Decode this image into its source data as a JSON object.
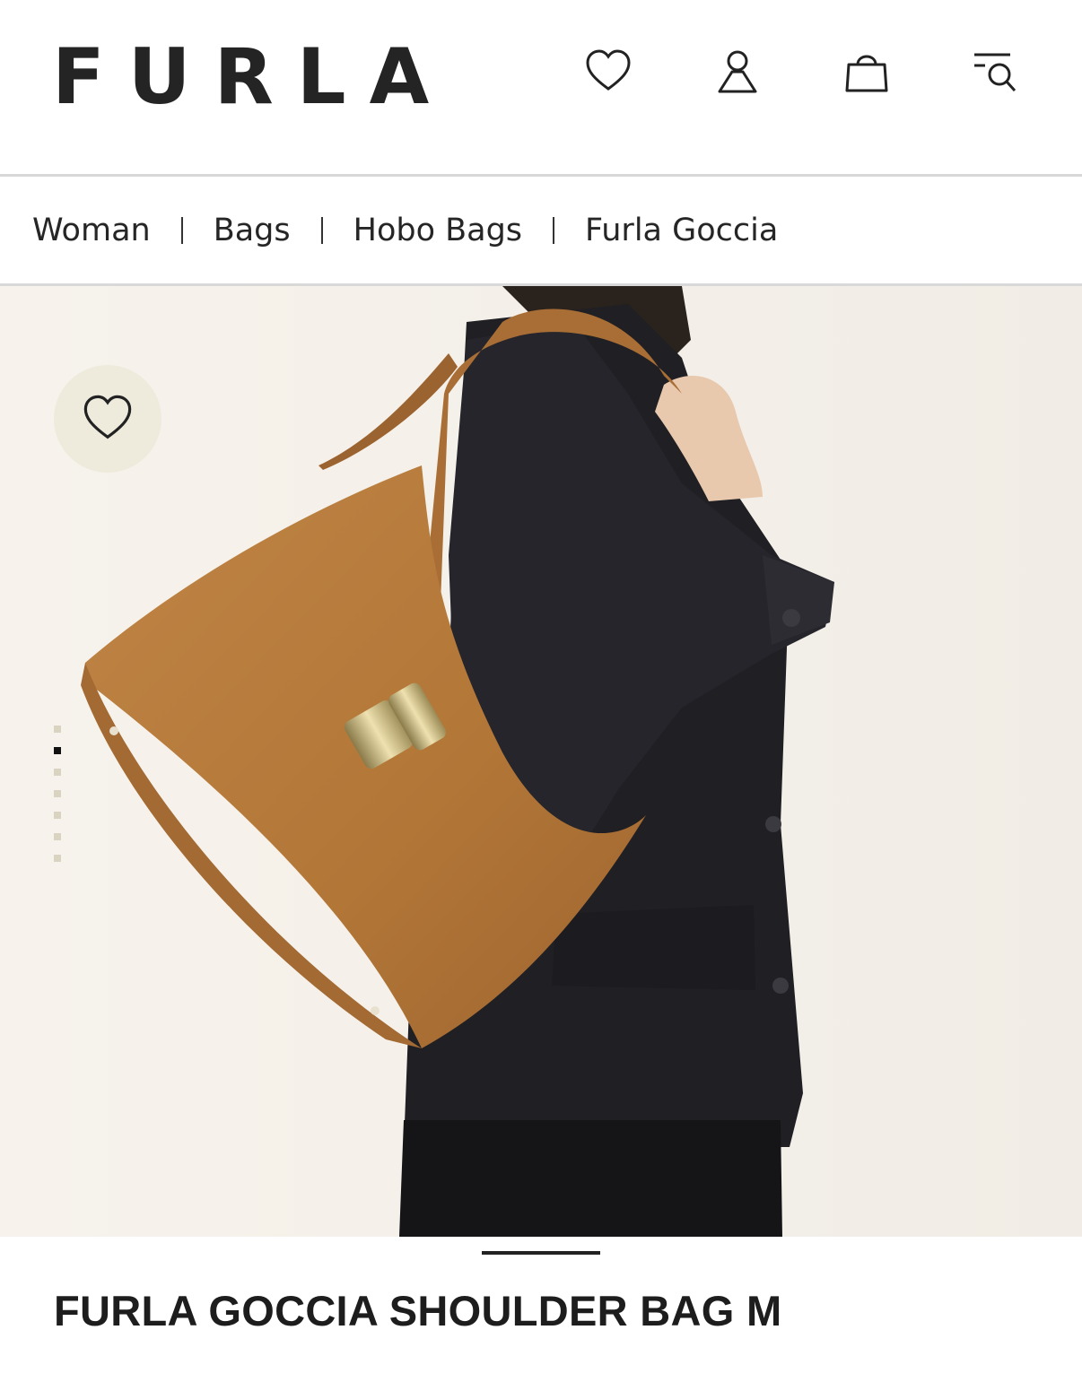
{
  "header": {
    "logo": "FURLA",
    "icons": [
      "heart-icon",
      "account-icon",
      "bag-icon",
      "search-menu-icon"
    ]
  },
  "breadcrumb": [
    "Woman",
    "Bags",
    "Hobo Bags",
    "Furla Goccia"
  ],
  "gallery": {
    "image_count": 7,
    "active_index": 1,
    "wishlist_icon": "heart-icon"
  },
  "product": {
    "title": "FURLA GOCCIA SHOULDER BAG M"
  },
  "colors": {
    "background": "#ffffff",
    "text": "#1f1f1f",
    "photo_background": "#f5f1ea",
    "bag": "#b57a3e",
    "jacket": "#1f1f24",
    "wish_bg": "#eeebdd"
  }
}
